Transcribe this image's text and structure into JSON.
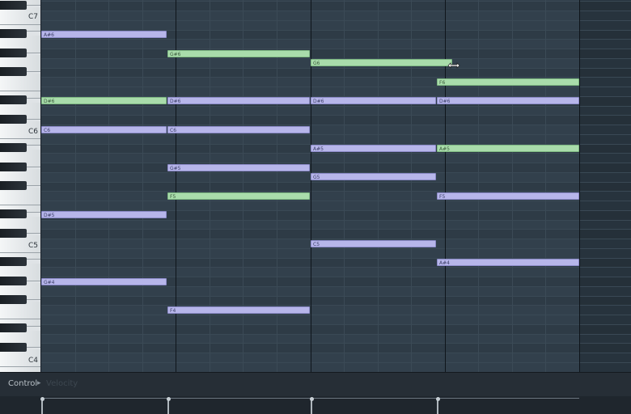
{
  "keyboard": {
    "octave_labels": [
      "C7",
      "C6",
      "C5",
      "C4"
    ]
  },
  "notes": [
    {
      "label": "A#6",
      "color": "purple"
    },
    {
      "label": "G#6",
      "color": "green"
    },
    {
      "label": "G6",
      "color": "green"
    },
    {
      "label": "F6",
      "color": "green"
    },
    {
      "label": "D#6",
      "color": "green"
    },
    {
      "label": "D#6",
      "color": "purple"
    },
    {
      "label": "D#6",
      "color": "purple"
    },
    {
      "label": "D#6",
      "color": "purple"
    },
    {
      "label": "C6",
      "color": "purple"
    },
    {
      "label": "C6",
      "color": "purple"
    },
    {
      "label": "A#5",
      "color": "purple"
    },
    {
      "label": "A#5",
      "color": "green"
    },
    {
      "label": "G#5",
      "color": "purple"
    },
    {
      "label": "G5",
      "color": "purple"
    },
    {
      "label": "F5",
      "color": "green"
    },
    {
      "label": "F5",
      "color": "purple"
    },
    {
      "label": "D#5",
      "color": "purple"
    },
    {
      "label": "C5",
      "color": "purple"
    },
    {
      "label": "A#4",
      "color": "purple"
    },
    {
      "label": "G#4",
      "color": "purple"
    },
    {
      "label": "F4",
      "color": "purple"
    }
  ],
  "control_bar": {
    "label": "Control",
    "arrow": "▸",
    "value": "Velocity"
  },
  "colors": {
    "note_purple": "#b7b6ea",
    "note_green": "#a9dcab",
    "grid_bg": "#32404c"
  }
}
